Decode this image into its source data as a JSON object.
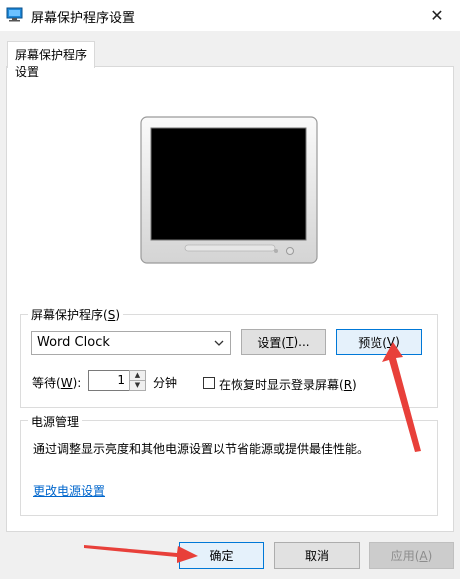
{
  "window": {
    "title": "屏幕保护程序设置",
    "icon": "display-settings-icon",
    "close_icon": "close-icon",
    "close_glyph": "✕"
  },
  "tabs": [
    {
      "label": "屏幕保护程序设置",
      "active": true
    }
  ],
  "screensaver": {
    "group_label_text": "屏幕保护程序(",
    "group_label_key": "S",
    "group_label_end": ")",
    "selected": "Word Clock",
    "settings_text": "设置(",
    "settings_key": "T",
    "settings_end": ")...",
    "preview_text": "预览(",
    "preview_key": "V",
    "preview_end": ")",
    "wait_text": "等待(",
    "wait_key": "W",
    "wait_end": "):",
    "wait_value": "1",
    "wait_unit": "分钟",
    "resume_checkbox_label": "在恢复时显示登录屏幕(",
    "resume_checkbox_key": "R",
    "resume_checkbox_end": ")",
    "resume_checked": false
  },
  "power": {
    "group_label": "电源管理",
    "description": "通过调整显示亮度和其他电源设置以节省能源或提供最佳性能。",
    "link": "更改电源设置"
  },
  "footer": {
    "ok": "确定",
    "cancel": "取消",
    "apply_text": "应用(",
    "apply_key": "A",
    "apply_end": ")",
    "apply_enabled": false
  },
  "annotation_color": "#e8403a"
}
